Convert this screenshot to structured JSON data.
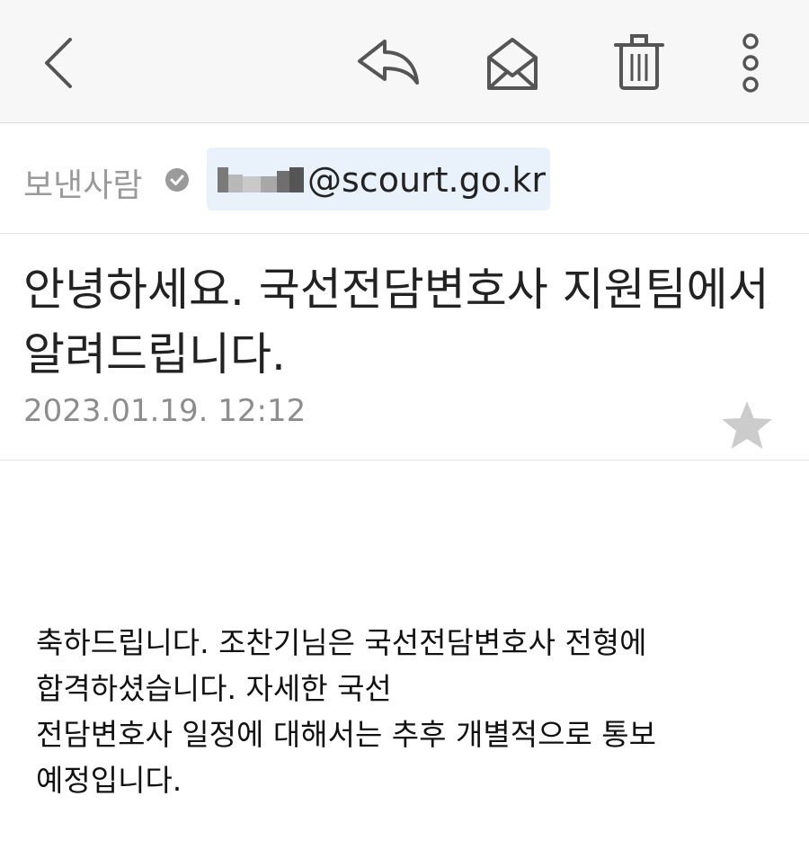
{
  "toolbar": {
    "back_icon": "chevron-left-icon",
    "reply_icon": "reply-arrow-icon",
    "mail_icon": "envelope-open-icon",
    "trash_icon": "trash-can-icon",
    "more_icon": "vertical-dots-icon"
  },
  "sender": {
    "label": "보낸사람",
    "domain": "@scourt.go.kr",
    "verified_icon": "check-circle-icon"
  },
  "message": {
    "subject": "안녕하세요. 국선전담변호사 지원팀에서 알려드립니다.",
    "date": "2023.01.19. 12:12",
    "star_icon": "star-icon",
    "body_lines": [
      "축하드립니다. 조찬기님은 국선전담변호사 전형에",
      "합격하셨습니다. 자세한 국선",
      "전담변호사 일정에 대해서는 추후 개별적으로 통보",
      "예정입니다."
    ]
  },
  "colors": {
    "toolbar_bg": "#f7f7f7",
    "chip_bg": "#e9f2fb",
    "muted_text": "#9a9a9a",
    "icon_stroke": "#555555",
    "star_fill": "#cccccc"
  }
}
